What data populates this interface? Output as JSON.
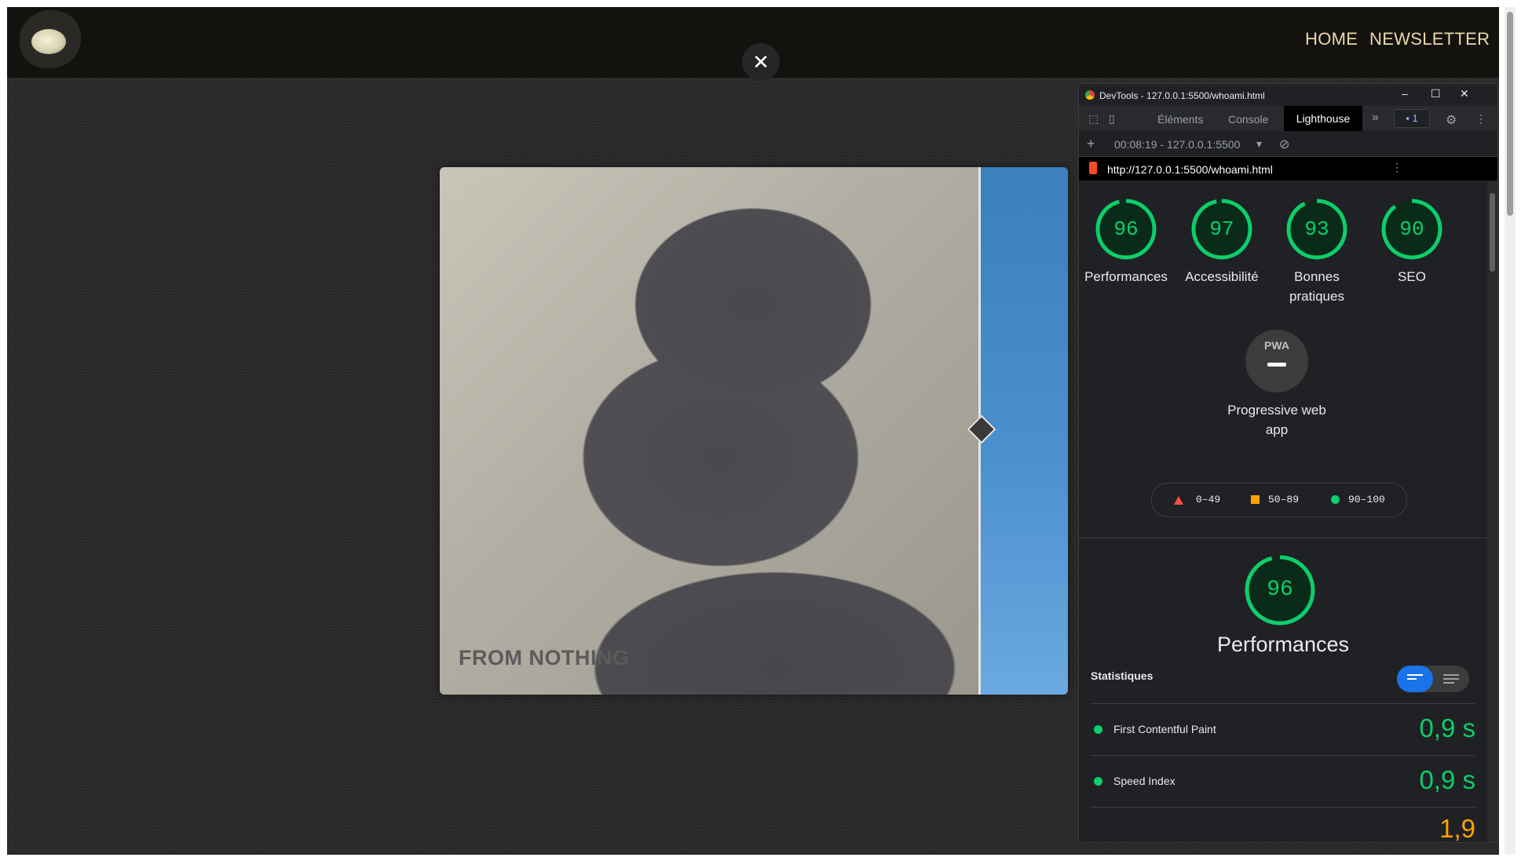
{
  "nav": {
    "home": "HOME",
    "newsletter": "NEWSLETTER"
  },
  "lightbox": {
    "close_glyph": "✕",
    "caption": "FROM NOTHING"
  },
  "devtools": {
    "window_title": "DevTools - 127.0.0.1:5500/whoami.html",
    "window_buttons": {
      "minimize": "–",
      "maximize": "☐",
      "close": "✕"
    },
    "tabs": {
      "elements": "Éléments",
      "console": "Console",
      "lighthouse": "Lighthouse",
      "more": "»",
      "issues_count": "1"
    },
    "run": {
      "add": "+",
      "label": "00:08:19 - 127.0.0.1:5500",
      "dropdown": "▾",
      "clear": "⊘"
    },
    "url": "http://127.0.0.1:5500/whoami.html",
    "scores": [
      {
        "value": "96",
        "label": "Performances"
      },
      {
        "value": "97",
        "label": "Accessibilité"
      },
      {
        "value": "93",
        "label": "Bonnes pratiques"
      },
      {
        "value": "90",
        "label": "SEO"
      }
    ],
    "pwa": {
      "badge": "PWA",
      "label": "Progressive web app"
    },
    "legend": {
      "fail": "0–49",
      "average": "50–89",
      "pass": "90–100"
    },
    "performance": {
      "score": "96",
      "title": "Performances"
    },
    "stats_title": "Statistiques",
    "metrics": [
      {
        "name": "First Contentful Paint",
        "value": "0,9 s"
      },
      {
        "name": "Speed Index",
        "value": "0,9 s"
      }
    ],
    "partial_value": "1,9"
  },
  "colors": {
    "pass": "#0cce6b",
    "average": "#ffa400",
    "fail": "#ff4e42",
    "nav_text": "#e9d9a9",
    "devtools_bg": "#202124"
  }
}
